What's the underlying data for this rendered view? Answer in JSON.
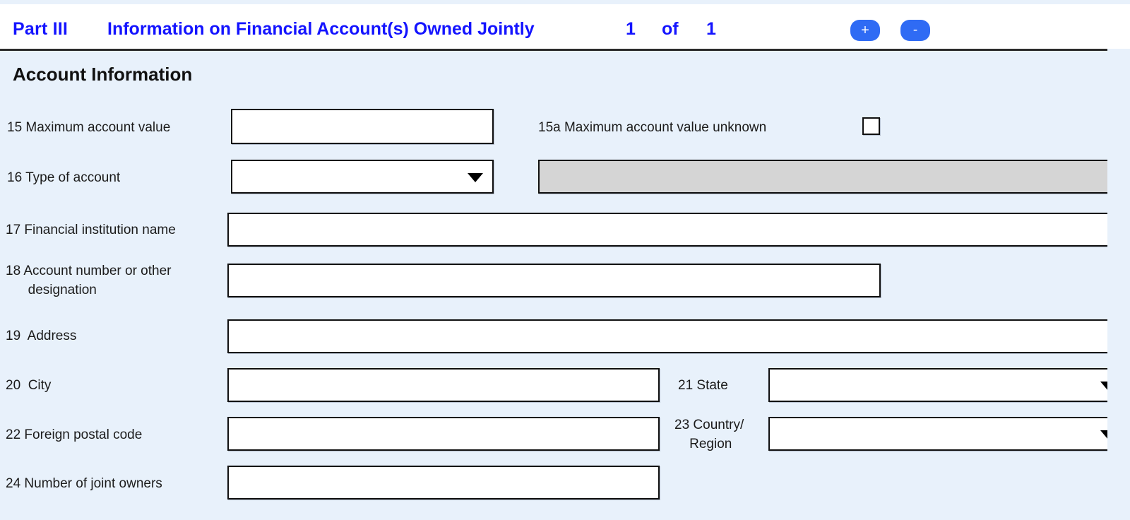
{
  "header": {
    "part_label": "Part III",
    "title": "Information on Financial Account(s) Owned Jointly",
    "index": "1",
    "of": "of",
    "total": "1",
    "add_button": "+",
    "remove_button": "-",
    "accent_color": "#1414ff",
    "button_color": "#2f6bf4"
  },
  "section": {
    "title": "Account Information"
  },
  "fields": {
    "f15": {
      "label": "15 Maximum account value",
      "value": "",
      "type": "text"
    },
    "f15a": {
      "label": "15a Maximum account value unknown",
      "checked": false,
      "type": "checkbox"
    },
    "f16": {
      "label": "16 Type of account",
      "value": "",
      "type": "select",
      "options": [
        ""
      ]
    },
    "f16_disabled": {
      "label": "",
      "value": "",
      "type": "text",
      "disabled": true
    },
    "f17": {
      "label": "17 Financial institution name",
      "value": "",
      "type": "text"
    },
    "f18": {
      "label": "18 Account number or other\n      designation",
      "value": "",
      "type": "text"
    },
    "f19": {
      "label": "19  Address",
      "value": "",
      "type": "text"
    },
    "f20": {
      "label": "20  City",
      "value": "",
      "type": "text"
    },
    "f21": {
      "label": "21 State",
      "value": "",
      "type": "select",
      "options": [
        ""
      ]
    },
    "f22": {
      "label": "22 Foreign postal code",
      "value": "",
      "type": "text"
    },
    "f23": {
      "label": "23 Country/\n    Region",
      "value": "",
      "type": "select",
      "options": [
        ""
      ]
    },
    "f24": {
      "label": "24 Number of joint owners",
      "value": "",
      "type": "text"
    }
  }
}
